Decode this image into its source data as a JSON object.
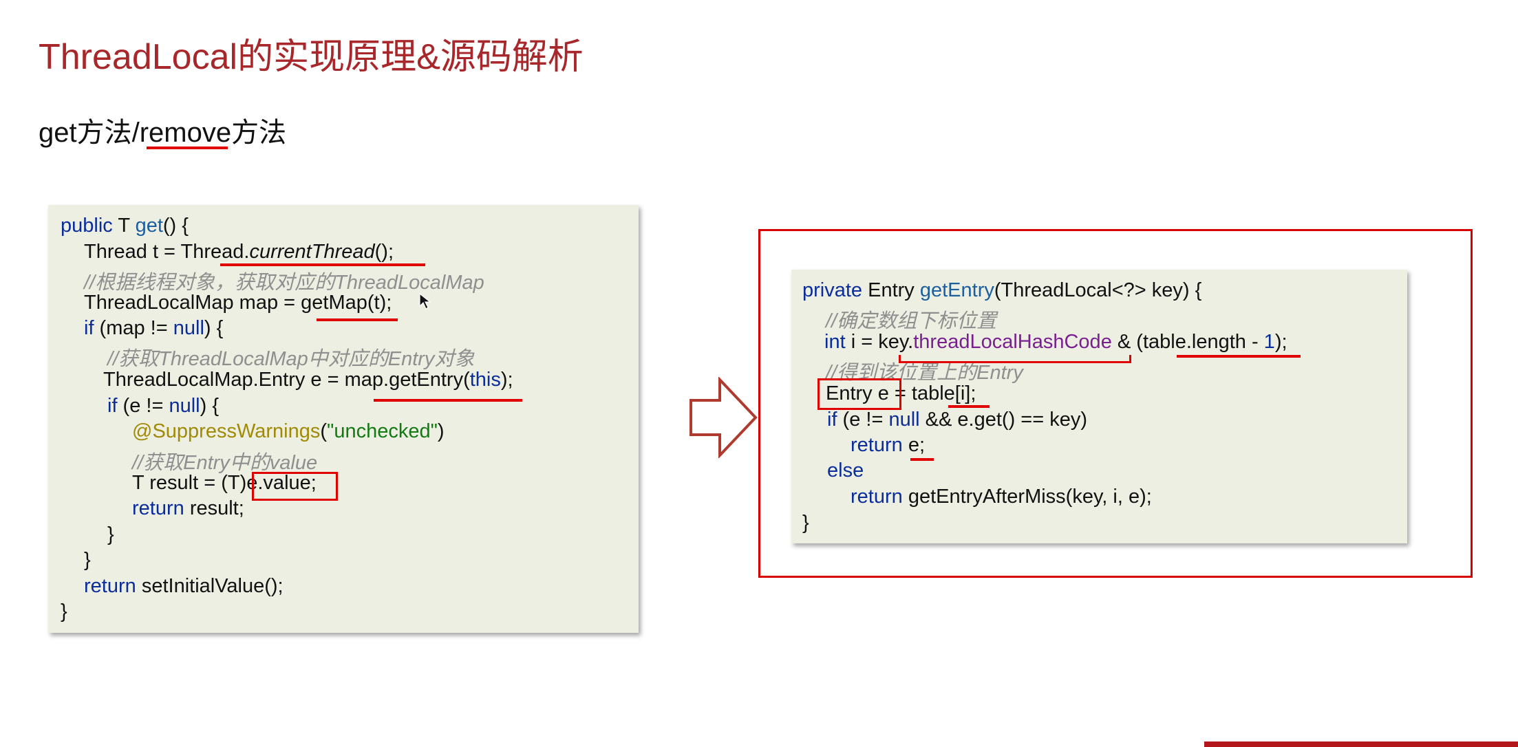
{
  "slide": {
    "title": "ThreadLocal的实现原理&源码解析",
    "subtitle": "get方法/remove方法"
  },
  "code_get": {
    "l1": {
      "kw": "public",
      "a": " T ",
      "fn": "get",
      "b": "() {"
    },
    "l2": {
      "a": "Thread t = Thread.",
      "it": "currentThread",
      "b": "();"
    },
    "l3": {
      "cm": "//根据线程对象，获取对应的ThreadLocalMap"
    },
    "l4": {
      "a": "ThreadLocalMap map = getMap(t);"
    },
    "l5": {
      "kw1": "if",
      "a": " (map != ",
      "kw2": "null",
      "b": ") {"
    },
    "l6": {
      "cm": "//获取ThreadLocalMap中对应的Entry对象"
    },
    "l7": {
      "a": "ThreadLocalMap.Entry e = map.getEntry(",
      "kw": "this",
      "b": ");"
    },
    "l8": {
      "kw1": "if",
      "a": " (e != ",
      "kw2": "null",
      "b": ") {"
    },
    "l9": {
      "an": "@SuppressWarnings",
      "a": "(",
      "st": "\"unchecked\"",
      "b": ")"
    },
    "l10": {
      "cm": "//获取Entry中的value"
    },
    "l11": {
      "a": "T result = (T)",
      "b": "e.value;"
    },
    "l12": {
      "kw": "return",
      "a": " result;"
    },
    "l13": {
      "a": "}"
    },
    "l14": {
      "a": "}"
    },
    "l15": {
      "kw": "return",
      "a": " setInitialValue();"
    },
    "l16": {
      "a": "}"
    }
  },
  "code_entry": {
    "l1": {
      "kw": "private",
      "a": " Entry ",
      "fn": "getEntry",
      "b": "(ThreadLocal<?> key) {"
    },
    "l2": {
      "cm": "//确定数组下标位置"
    },
    "l3": {
      "kw": "int",
      "a": " i = key.",
      "pu": "threadLocalHashCode",
      "b": " & (table.length - ",
      "num": "1",
      "c": ");"
    },
    "l4": {
      "cm": "//得到该位置上的Entry"
    },
    "l5": {
      "a": "Entry e = table[i];"
    },
    "l6": {
      "kw1": "if",
      "a": " (e != ",
      "kw2": "null",
      "b": " && e.get() == key)"
    },
    "l7": {
      "kw": "return",
      "a": " e;"
    },
    "l8": {
      "kw": "else"
    },
    "l9": {
      "kw": "return",
      "a": " getEntryAfterMiss(key, i, e);"
    },
    "l10": {
      "a": "}"
    }
  },
  "icons": {
    "arrow": "right-arrow-outline-icon",
    "cursor": "mouse-pointer-icon"
  },
  "colors": {
    "title": "#a8272b",
    "highlight": "#e00000",
    "code_bg": "#ecefe2",
    "keyword": "#0b2d9b"
  }
}
